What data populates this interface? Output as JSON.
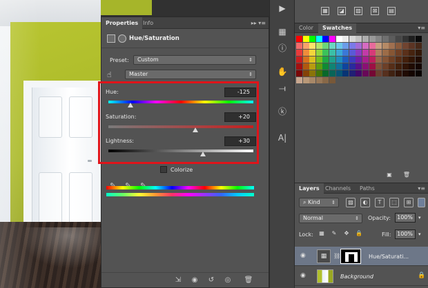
{
  "properties": {
    "tabs": [
      "Properties",
      "Info"
    ],
    "title": "Hue/Saturation",
    "preset_label": "Preset:",
    "preset_value": "Custom",
    "channel_value": "Master",
    "hue_label": "Hue:",
    "hue_value": "-125",
    "hue_level": -125,
    "saturation_label": "Saturation:",
    "saturation_value": "+20",
    "saturation_level": 20,
    "lightness_label": "Lightness:",
    "lightness_value": "+30",
    "lightness_level": 30,
    "colorize_label": "Colorize"
  },
  "swatches": {
    "tabs": [
      "Color",
      "Swatches"
    ],
    "rows": [
      [
        "#ff0000",
        "#ffff00",
        "#00ff00",
        "#00ffff",
        "#0000ff",
        "#ff00ff",
        "#ffffff",
        "#ebebeb",
        "#d6d6d6",
        "#c2c2c2",
        "#adadad",
        "#999999",
        "#858585",
        "#707070",
        "#5c5c5c",
        "#474747",
        "#333333",
        "#1f1f1f",
        "#0a0a0a"
      ],
      [
        "#f26b6b",
        "#f7a26b",
        "#fce36b",
        "#b5e36b",
        "#6bd67a",
        "#6bd6c2",
        "#6bc6e8",
        "#6b9ce8",
        "#7a7ae8",
        "#a36bd6",
        "#d66bc2",
        "#e86b9c",
        "#c79f80",
        "#b58a66",
        "#a07050",
        "#8a5a3c",
        "#704430",
        "#5c3524",
        "#472818"
      ],
      [
        "#e83b3b",
        "#ef8c3b",
        "#f5d63b",
        "#94d63b",
        "#3bc25a",
        "#3bbfa8",
        "#3ba8d6",
        "#3b78d6",
        "#5a5ad6",
        "#8a3bc2",
        "#c23ba8",
        "#d63b78",
        "#b08060",
        "#9c6c48",
        "#865634",
        "#704024",
        "#5a301a",
        "#462410",
        "#321808"
      ],
      [
        "#c71f1f",
        "#d6701f",
        "#dcbf1f",
        "#78bd1f",
        "#1fa844",
        "#1fa08c",
        "#1f8cbd",
        "#1f5cbd",
        "#3c3cbd",
        "#701fa8",
        "#a81f8c",
        "#bd1f5c",
        "#98684a",
        "#845436",
        "#6e4024",
        "#582e16",
        "#44200c",
        "#321606",
        "#200c02"
      ],
      [
        "#a31010",
        "#b05810",
        "#b89c10",
        "#5c9c10",
        "#108a34",
        "#108474",
        "#10709c",
        "#10449c",
        "#2a2a9c",
        "#58108a",
        "#8a1074",
        "#9c1044",
        "#805238",
        "#6c4028",
        "#562e18",
        "#42200c",
        "#301406",
        "#200c02",
        "#140601"
      ],
      [
        "#7a0808",
        "#844208",
        "#8a7408",
        "#447408",
        "#08682a",
        "#086458",
        "#085474",
        "#083474",
        "#201f74",
        "#420868",
        "#680858",
        "#740834",
        "#6a4030",
        "#56301e",
        "#402212",
        "#301408",
        "#200c04",
        "#140601",
        "#0a0301"
      ],
      [
        "#c8a890",
        "#b89878",
        "#a88868",
        "#987858",
        "#886848",
        "#785838"
      ]
    ]
  },
  "layers": {
    "tabs": [
      "Layers",
      "Channels",
      "Paths"
    ],
    "filter_label": "Kind",
    "blend_mode": "Normal",
    "opacity_label": "Opacity:",
    "opacity_value": "100%",
    "lock_label": "Lock:",
    "fill_label": "Fill:",
    "fill_value": "100%",
    "items": [
      {
        "name": "Hue/Saturati..."
      },
      {
        "name": "Background"
      }
    ]
  }
}
